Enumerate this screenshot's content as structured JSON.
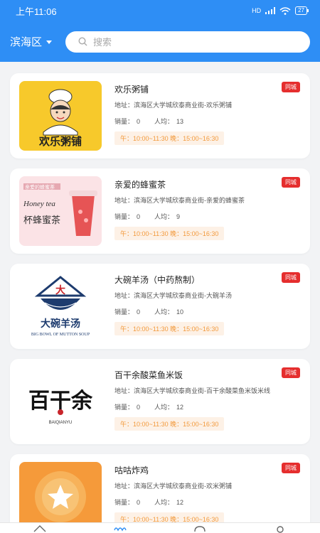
{
  "status": {
    "time": "上午11:06",
    "signal": "HD",
    "battery": "27"
  },
  "header": {
    "district": "滨海区",
    "search_placeholder": "搜索"
  },
  "shops": [
    {
      "name": "欢乐粥铺",
      "tag": "同城",
      "address": "地址：滨海区大学城欣泰商业街-欢乐粥铺",
      "sales_label": "销量：",
      "sales": "0",
      "avg_label": "人均：",
      "avg": "13",
      "hours": "午：10:00~11:30  晚：15:00~16:30"
    },
    {
      "name": "亲爱的蜂蜜茶",
      "tag": "同城",
      "address": "地址：滨海区大学城欣泰商业街-亲爱的蜂蜜茶",
      "sales_label": "销量：",
      "sales": "0",
      "avg_label": "人均：",
      "avg": "9",
      "hours": "午：10:00~11:30  晚：15:00~16:30"
    },
    {
      "name": "大碗羊汤（中药熬制）",
      "tag": "同城",
      "address": "地址：滨海区大学城欣泰商业街-大碗羊汤",
      "sales_label": "销量：",
      "sales": "0",
      "avg_label": "人均：",
      "avg": "10",
      "hours": "午：10:00~11:30  晚：15:00~16:30"
    },
    {
      "name": "百干余酸菜鱼米饭",
      "tag": "同城",
      "address": "地址：滨海区大学城欣泰商业街-百干余酸菜鱼米饭米线",
      "sales_label": "销量：",
      "sales": "0",
      "avg_label": "人均：",
      "avg": "12",
      "hours": "午：10:00~11:30  晚：15:00~16:30"
    },
    {
      "name": "咕咕炸鸡",
      "tag": "同城",
      "address": "地址：滨海区大学城欣泰商业街-欢米粥铺",
      "sales_label": "销量：",
      "sales": "0",
      "avg_label": "人均：",
      "avg": "12",
      "hours": "午：10:00~11:30  晚：15:00~16:30"
    }
  ],
  "logos": {
    "shop1": "欢乐粥铺",
    "shop2_top": "亲爱的蜂蜜茶",
    "shop2_en": "Honey tea",
    "shop2_bottom": "杯蜂蜜茶",
    "shop3_mark": "大",
    "shop3_cn": "大碗羊汤",
    "shop3_en": "BIG BOWL OF MUTTON SOUP",
    "shop4_cn": "百干余",
    "shop4_en": "BAIQIANYU"
  },
  "colors": {
    "primary": "#2e8ef5",
    "badge": "#e52e2e",
    "hours_text": "#f29a3d",
    "hours_bg": "#fdf1e6"
  }
}
